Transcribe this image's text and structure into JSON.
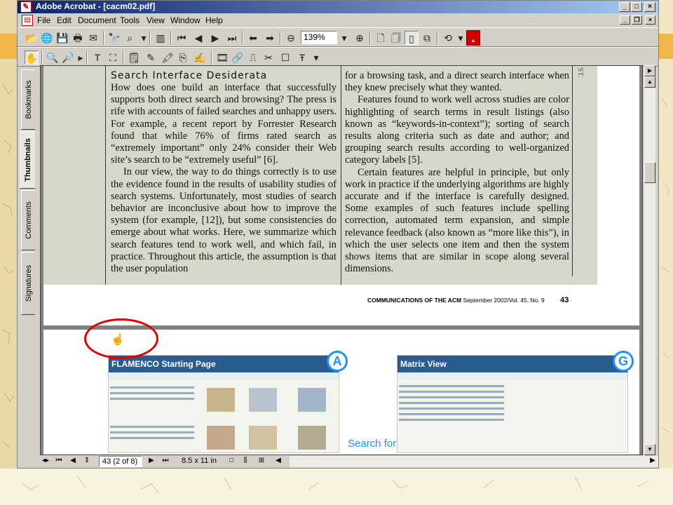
{
  "window": {
    "title": "Adobe Acrobat - [cacm02.pdf]",
    "controls": {
      "minimize": "_",
      "maximize": "□",
      "close": "×"
    },
    "mdi_controls": {
      "minimize": "_",
      "restore": "❐",
      "close": "×"
    }
  },
  "menu": [
    "File",
    "Edit",
    "Document",
    "Tools",
    "View",
    "Window",
    "Help"
  ],
  "toolbar": {
    "zoom_value": "139%"
  },
  "side_tabs": [
    "Bookmarks",
    "Thumbnails",
    "Comments",
    "Signatures"
  ],
  "page1": {
    "heading": "Search Interface Desiderata",
    "col1_p1": "How does one build an interface that successfully supports both direct search and browsing? The press is rife with accounts of failed searches and unhappy users. For example, a recent report by Forrester Research found that while 76% of firms rated search as “extremely important” only 24% consider their Web site’s search to be “extremely useful” [6].",
    "col1_p2": "In our view, the way to do things correctly is to use the evidence found in the results of usability studies of search systems. Unfortunately, most studies of search behavior are inconclusive about how to improve the system (for example, [12]), but some consistencies do emerge about what works. Here, we summarize which search features tend to work well, and which fail, in practice. Throughout this article, the assumption is that the user population",
    "col2_p1": "for a browsing task, and a direct search interface when they knew precisely what they wanted.",
    "col2_p2": "Features found to work well across studies are color highlighting of search terms in result listings (also known as “keywords-in-context”); sorting of search results along criteria such as date and author; and grouping search results according to well-organized category labels [5].",
    "col2_p3": "Certain features are helpful in principle, but only work in practice if the underlying algorithms are highly accurate and if the interface is carefully designed. Some examples of such features include spelling correction, automated term expansion, and simple relevance feedback (also known as “more like this”), in which the user selects one item and then the system shows items that are similar in scope along several dimensions.",
    "margin_text": "ST.",
    "footer_journal": "COMMUNICATIONS OF THE ACM",
    "footer_issue": "September 2002/Vol. 45, No. 9",
    "footer_page": "43"
  },
  "page2": {
    "shot_a_title": "FLAMENCO Starting Page",
    "shot_b_title": "Matrix View",
    "badge_a": "A",
    "badge_g": "G",
    "caption": "Search for"
  },
  "status": {
    "page_field": "43  (2 of 8)",
    "page_size": "8.5 x 11 in"
  },
  "colors": {
    "title_start": "#0a246a",
    "title_end": "#a6caf0",
    "annotation": "#e00000",
    "badge": "#1e90ff"
  }
}
